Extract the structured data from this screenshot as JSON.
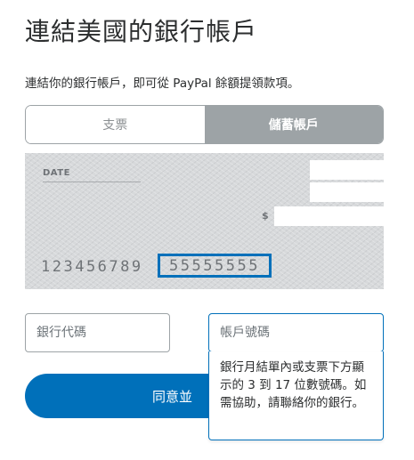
{
  "page": {
    "title": "連結美國的銀行帳戶",
    "subtitle": "連結你的銀行帳戶，即可從 PayPal 餘額提領款項。"
  },
  "toggle": {
    "options": [
      "支票",
      "儲蓄帳戶"
    ],
    "selected": "儲蓄帳戶"
  },
  "check": {
    "date_label": "DATE",
    "dollar_sign": "$",
    "routing_digits": "123456789",
    "account_digits": "55555555"
  },
  "form": {
    "routing_placeholder": "銀行代碼",
    "account_placeholder": "帳戶號碼",
    "agree_label": "同意並"
  },
  "tooltip": {
    "text": "銀行月結單內或支票下方顯示的 3 到 17 位數號碼。如需協助，請聯絡你的銀行。"
  },
  "colors": {
    "accent": "#0070ba",
    "toggle_active_bg": "#9da3a6",
    "check_bg": "#d7d9db"
  }
}
